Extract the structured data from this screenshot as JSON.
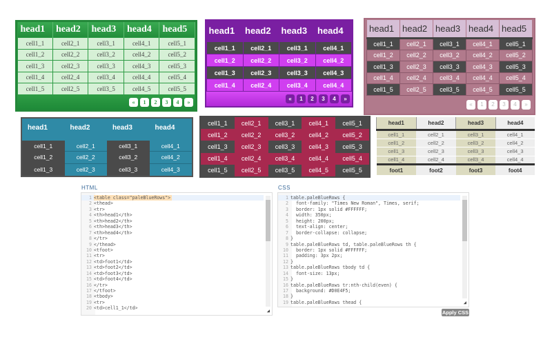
{
  "tables": [
    {
      "id": "green",
      "headers": [
        "head1",
        "head2",
        "head3",
        "head4",
        "head5"
      ],
      "rows": [
        [
          "cell1_1",
          "cell2_1",
          "cell3_1",
          "cell4_1",
          "cell5_1"
        ],
        [
          "cell1_2",
          "cell2_2",
          "cell3_2",
          "cell4_2",
          "cell5_2"
        ],
        [
          "cell1_3",
          "cell2_3",
          "cell3_3",
          "cell4_3",
          "cell5_3"
        ],
        [
          "cell1_4",
          "cell2_4",
          "cell3_4",
          "cell4_4",
          "cell5_4"
        ],
        [
          "cell1_5",
          "cell2_5",
          "cell3_5",
          "cell4_5",
          "cell5_5"
        ]
      ],
      "pagination": [
        "«",
        "1",
        "2",
        "3",
        "4",
        "»"
      ],
      "accent": "#2e9c45"
    },
    {
      "id": "purple",
      "headers": [
        "head1",
        "head2",
        "head3",
        "head4"
      ],
      "rows": [
        [
          "cell1_1",
          "cell2_1",
          "cell3_1",
          "cell4_1"
        ],
        [
          "cell1_2",
          "cell2_2",
          "cell3_2",
          "cell4_2"
        ],
        [
          "cell1_3",
          "cell2_3",
          "cell3_3",
          "cell4_3"
        ],
        [
          "cell1_4",
          "cell2_4",
          "cell3_4",
          "cell4_4"
        ]
      ],
      "pagination": [
        "«",
        "1",
        "2",
        "3",
        "4",
        "»"
      ],
      "accent": "#7a1fa2"
    },
    {
      "id": "pink",
      "headers": [
        "head1",
        "head2",
        "head3",
        "head4",
        "head5"
      ],
      "rows": [
        [
          "cell1_1",
          "cell2_1",
          "cell3_1",
          "cell4_1",
          "cell5_1"
        ],
        [
          "cell1_2",
          "cell2_2",
          "cell3_2",
          "cell4_2",
          "cell5_2"
        ],
        [
          "cell1_3",
          "cell2_3",
          "cell3_3",
          "cell4_3",
          "cell5_3"
        ],
        [
          "cell1_4",
          "cell2_4",
          "cell3_4",
          "cell4_4",
          "cell5_4"
        ],
        [
          "cell1_5",
          "cell2_5",
          "cell3_5",
          "cell4_5",
          "cell5_5"
        ]
      ],
      "pagination": [
        "«",
        "1",
        "2",
        "3",
        "4",
        "»"
      ],
      "accent": "#b17a8c"
    },
    {
      "id": "blue",
      "headers": [
        "head1",
        "head2",
        "head3",
        "head4"
      ],
      "rows": [
        [
          "cell1_1",
          "cell2_1",
          "cell3_1",
          "cell4_1"
        ],
        [
          "cell1_2",
          "cell2_2",
          "cell3_2",
          "cell4_2"
        ],
        [
          "cell1_3",
          "cell2_3",
          "cell3_3",
          "cell4_3"
        ]
      ],
      "accent": "#2f8aa6"
    },
    {
      "id": "crimson",
      "headers": [],
      "rows": [
        [
          "cell1_1",
          "cell2_1",
          "cell3_1",
          "cell4_1",
          "cell5_1"
        ],
        [
          "cell1_2",
          "cell2_2",
          "cell3_2",
          "cell4_2",
          "cell5_2"
        ],
        [
          "cell1_3",
          "cell2_3",
          "cell3_3",
          "cell4_3",
          "cell5_3"
        ],
        [
          "cell1_4",
          "cell2_4",
          "cell3_4",
          "cell4_4",
          "cell5_4"
        ],
        [
          "cell1_5",
          "cell2_5",
          "cell3_5",
          "cell4_5",
          "cell5_5"
        ]
      ],
      "accent": "#a8294f"
    },
    {
      "id": "khaki",
      "headers": [
        "head1",
        "head2",
        "head3",
        "head4"
      ],
      "rows": [
        [
          "cell1_1",
          "cell2_1",
          "cell3_1",
          "cell4_1"
        ],
        [
          "cell1_2",
          "cell2_2",
          "cell3_2",
          "cell4_2"
        ],
        [
          "cell1_3",
          "cell2_3",
          "cell3_3",
          "cell4_3"
        ],
        [
          "cell1_4",
          "cell2_4",
          "cell3_4",
          "cell4_4"
        ]
      ],
      "footers": [
        "foot1",
        "foot2",
        "foot3",
        "foot4"
      ],
      "accent": "#dcdbc0"
    }
  ],
  "html_editor": {
    "label": "HTML",
    "lines": [
      "<table class=\"paleBlueRows\">",
      "<thead>",
      "<tr>",
      "<th>head1</th>",
      "<th>head2</th>",
      "<th>head3</th>",
      "<th>head4</th>",
      "</tr>",
      "</thead>",
      "<tfoot>",
      "<tr>",
      "<td>foot1</td>",
      "<td>foot2</td>",
      "<td>foot3</td>",
      "<td>foot4</td>",
      "</tr>",
      "</tfoot>",
      "<tbody>",
      "<tr>",
      "<td>cell1_1</td>"
    ]
  },
  "css_editor": {
    "label": "CSS",
    "lines": [
      "table.paleBlueRows {",
      "  font-family: \"Times New Roman\", Times, serif;",
      "  border: 1px solid #FFFFFF;",
      "  width: 350px;",
      "  height: 200px;",
      "  text-align: center;",
      "  border-collapse: collapse;",
      "}",
      "table.paleBlueRows td, table.paleBlueRows th {",
      "  border: 1px solid #FFFFFF;",
      "  padding: 3px 2px;",
      "}",
      "table.paleBlueRows tbody td {",
      "  font-size: 13px;",
      "}",
      "table.paleBlueRows tr:nth-child(even) {",
      "  background: #D0E4F5;",
      "}",
      "table.paleBlueRows thead {"
    ],
    "apply_label": "Apply CSS"
  }
}
